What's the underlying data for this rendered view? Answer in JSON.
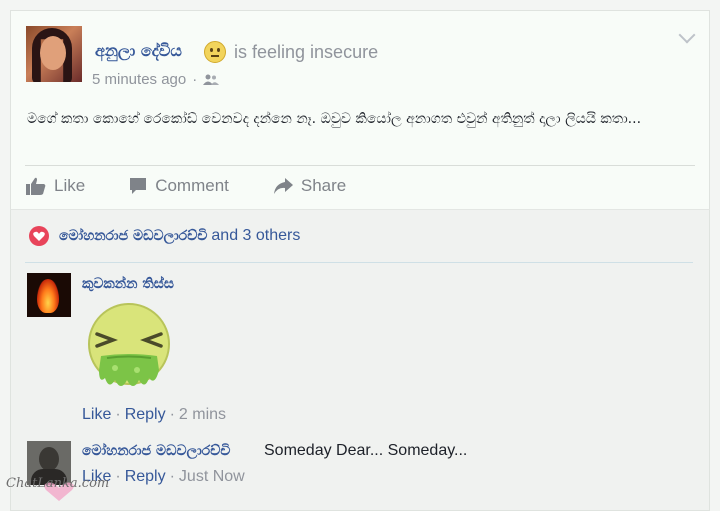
{
  "post": {
    "author": "අනුලා දේවිය",
    "feeling_text": "is feeling insecure",
    "feeling_icon": "neutral-face-emoji",
    "timestamp": "5 minutes ago",
    "privacy_icon": "friends-icon",
    "body": "මගේ කතා කොහේ රෙකෝඩ් වෙනවද දන්නෙ නෑ. ඔවුව කියෝල අනාගත එවුන් අතිනුත් දාලා ලියයි කතා...",
    "actions": {
      "like": "Like",
      "comment": "Comment",
      "share": "Share"
    }
  },
  "reactions": {
    "icon": "heart-icon",
    "names": "මෝහනරාජ මඩවලාරච්චි",
    "others": "and 3 others"
  },
  "comments": [
    {
      "author": "කුවකන්න තිස්ස",
      "sticker": "sick-vomiting-sticker",
      "like": "Like",
      "reply": "Reply",
      "time": "2 mins"
    },
    {
      "author": "මෝහනරාජ මඩවලාරච්චි",
      "text": "Someday Dear... Someday...",
      "like": "Like",
      "reply": "Reply",
      "time": "Just Now"
    }
  ],
  "watermark": "ChatLanka.com",
  "colors": {
    "link": "#365899",
    "muted": "#90949c",
    "heart": "#e8445a"
  }
}
